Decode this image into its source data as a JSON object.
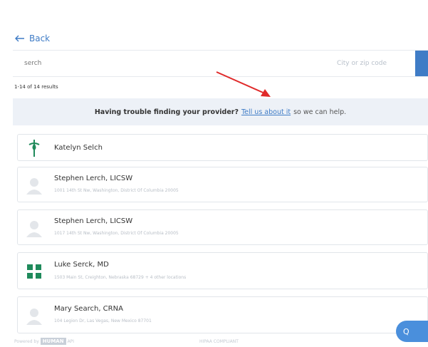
{
  "nav": {
    "back_label": "Back"
  },
  "search": {
    "query_value": "serch",
    "zip_placeholder": "City or zip code"
  },
  "results": {
    "count_text": "1-14 of 14 results"
  },
  "banner": {
    "question": "Having trouble finding your provider?",
    "link_text": "Tell us about it",
    "suffix": "so we can help."
  },
  "providers": [
    {
      "name": "Katelyn Selch",
      "address": "",
      "icon": "green-cross-logo-icon"
    },
    {
      "name": "Stephen Lerch, LICSW",
      "address": "1001 14th St Nw, Washington, District Of Columbia 20005",
      "icon": "person-avatar-icon"
    },
    {
      "name": "Stephen Lerch, LICSW",
      "address": "1017 14th St Nw, Washington, District Of Columbia 20005",
      "icon": "person-avatar-icon"
    },
    {
      "name": "Luke Serck, MD",
      "address": "1503 Main St, Creighton, Nebraska 68729 + 4 other locations",
      "icon": "green-clinic-logo-icon"
    },
    {
      "name": "Mary Search, CRNA",
      "address": "104 Legion Dr, Las Vegas, New Mexico 87701",
      "icon": "person-avatar-icon"
    }
  ],
  "footer": {
    "powered_by": "Powered by",
    "brand_a": "HUMAN",
    "brand_b": "API",
    "hipaa": "HIPAA COMPLIANT"
  },
  "chat": {
    "label": "Q"
  },
  "colors": {
    "accent": "#3f7cc6",
    "banner_bg": "#edf1f7",
    "arrow": "#e02a2a",
    "logo_green": "#1f8a5b"
  }
}
